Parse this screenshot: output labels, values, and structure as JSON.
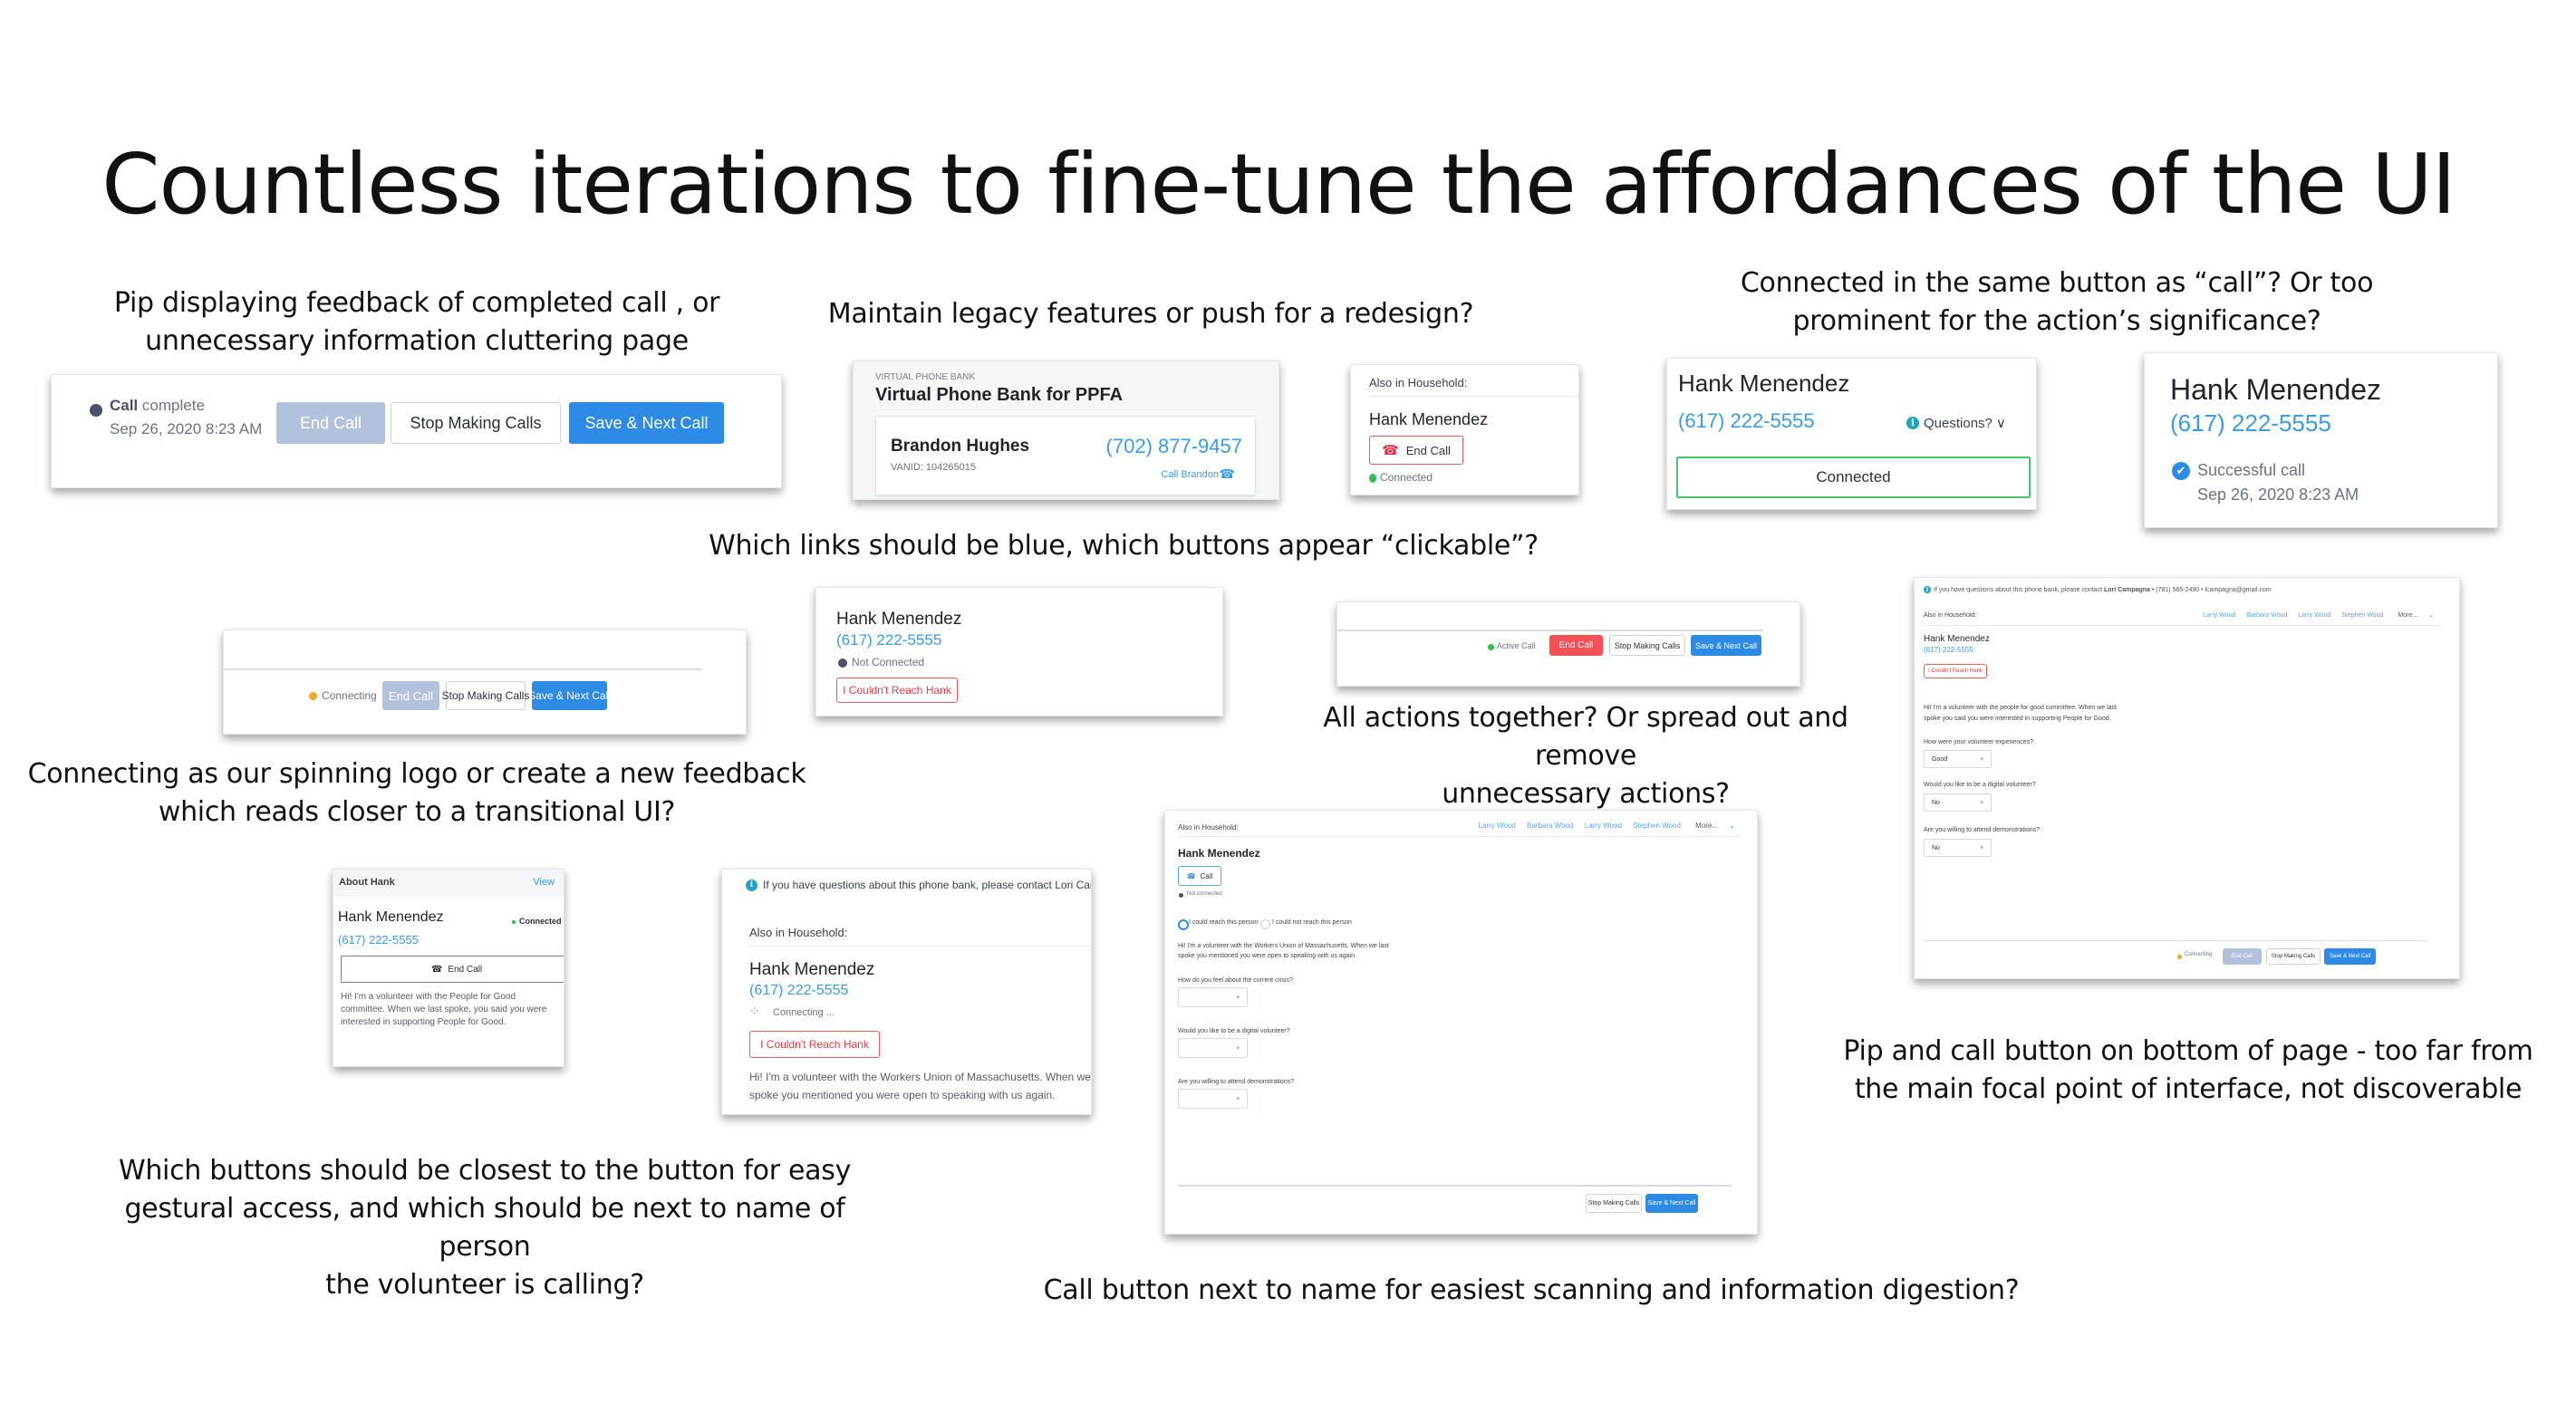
{
  "title": "Countless iterations to fine-tune the affordances of the UI",
  "captions": {
    "pip_feedback": [
      "Pip displaying feedback of completed call , or",
      "unnecessary information cluttering page"
    ],
    "legacy": [
      "Maintain legacy features or push for a redesign?"
    ],
    "connected_button": [
      "Connected in the same button as “call”? Or too",
      "prominent for the action’s significance?"
    ],
    "links_blue": [
      "Which links should be blue, which buttons appear “clickable”?"
    ],
    "actions_together": [
      "All actions together? Or spread out and remove",
      "unnecessary actions?"
    ],
    "connecting_logo": [
      "Connecting as our spinning logo or create a new feedback",
      "which reads closer to a transitional UI?"
    ],
    "pip_bottom": [
      "Pip and call button on bottom of page - too far from",
      "the main focal point of interface, not discoverable"
    ],
    "gestural": [
      "Which buttons should be closest to the button for easy",
      "gestural access, and which should be next to name of person",
      "the volunteer is calling?"
    ],
    "call_next_to_name": [
      "Call button next to name for easiest scanning and information digestion?"
    ]
  },
  "colors": {
    "primary": "#2d8ae5",
    "disabled": "#b3c2dc",
    "danger": "#f25158",
    "link": "#3a9be6",
    "connected_green": "#2fbf4f",
    "connecting_amber": "#f5a623",
    "not_connected_gray": "#4a5168"
  },
  "call_complete_pip": {
    "status_bold": "Call",
    "status_rest": "complete",
    "timestamp": "Sep 26, 2020 8:23 AM",
    "end_call": "End Call",
    "stop_making_calls": "Stop Making Calls",
    "save_next": "Save & Next Call"
  },
  "legacy_card": {
    "eyebrow": "VIRTUAL PHONE BANK",
    "heading": "Virtual Phone Bank for PPFA",
    "contact_name": "Brandon Hughes",
    "vanid": "VANID: 104265015",
    "phone": "(702) 877-9457",
    "call_link": "Call Brandon"
  },
  "household_end_call": {
    "label": "Also in Household:",
    "name": "Hank Menendez",
    "end_call": "End Call",
    "status": "Connected"
  },
  "connected_button_card": {
    "name": "Hank Menendez",
    "phone": "(617) 222-5555",
    "questions": "Questions?",
    "button": "Connected"
  },
  "successful_card": {
    "name": "Hank Menendez",
    "phone": "(617) 222-5555",
    "status": "Successful call",
    "timestamp": "Sep 26, 2020 8:23 AM"
  },
  "connecting_bar": {
    "status": "Connecting",
    "end_call": "End Call",
    "stop_making_calls": "Stop Making Calls",
    "save_next": "Save & Next Call"
  },
  "not_connected_card": {
    "name": "Hank Menendez",
    "phone": "(617) 222-5555",
    "status": "Not Connected",
    "couldnt_reach": "I Couldn't Reach Hank"
  },
  "active_call_bar": {
    "status": "Active Call",
    "end_call": "End Call",
    "stop_making_calls": "Stop Making Calls",
    "save_next": "Save & Next Call"
  },
  "full_page_right": {
    "info": "If you have questions about this phone bank, please contact",
    "contact_name": "Lori Campagna",
    "contact_phone": "(781) 565-2490",
    "contact_email": "lcampagna@gmail.com",
    "household_label": "Also in Household:",
    "household": [
      "Larry Wood",
      "Barbara Wood",
      "Larry Wood",
      "Stephen Wood"
    ],
    "more": "More...",
    "name": "Hank Menendez",
    "phone": "(617) 222-5555",
    "couldnt_reach": "I Couldn't Reach Hank",
    "script": "Hi! I'm a volunteer with the people for good committee. When we last spoke you said you were interested in supporting People for Good.",
    "questions": [
      {
        "label": "How were your volunteer experiences?",
        "value": "Good"
      },
      {
        "label": "Would you like to be a digital volunteer?",
        "value": "No"
      },
      {
        "label": "Are you willing to attend demonstrations?",
        "value": "No"
      }
    ],
    "status": "Connecting",
    "end_call": "End Call",
    "stop_making_calls": "Stop Making Calls",
    "save_next": "Save & Next Call"
  },
  "about_card": {
    "header": "About Hank",
    "view": "View",
    "name": "Hank Menendez",
    "status": "Connected",
    "phone": "(617) 222-5555",
    "end_call": "End Call",
    "script": "Hi! I'm a volunteer with the People for Good committee. When we last spoke, you said you were interested in supporting People for Good."
  },
  "connecting_card": {
    "info": "If you have questions about this phone bank, please contact",
    "contact_fragment": "Lori Campa",
    "household_label": "Also in Household:",
    "name": "Hank Menendez",
    "phone": "(617) 222-5555",
    "status": "Connecting ...",
    "couldnt_reach": "I Couldn't Reach Hank",
    "script_1": "Hi! I'm a volunteer with the Workers Union of Massachusetts. When we last",
    "script_2": "spoke you mentioned you were open to speaking with us again."
  },
  "full_page_middle": {
    "household_label": "Also in Household:",
    "household": [
      "Larry Wood",
      "Barbara Wood",
      "Larry Wood",
      "Stephen Wood"
    ],
    "more": "More...",
    "name": "Hank Menendez",
    "call": "Call",
    "status": "Not connected",
    "radio_reached": "I could reach this person",
    "radio_not_reached": "I could not reach this person",
    "script": "Hi! I'm a volunteer with the Workers Union of Massachusetts. When we last spoke you mentioned you were open to speaking with us again.",
    "questions": [
      {
        "label": "How do you feel about the current crisis?",
        "value": ""
      },
      {
        "label": "Would you like to be a digital volunteer?",
        "value": ""
      },
      {
        "label": "Are you willing to attend demonstrations?",
        "value": ""
      }
    ],
    "stop_making_calls": "Stop Making Calls",
    "save_next": "Save & Next Call"
  }
}
